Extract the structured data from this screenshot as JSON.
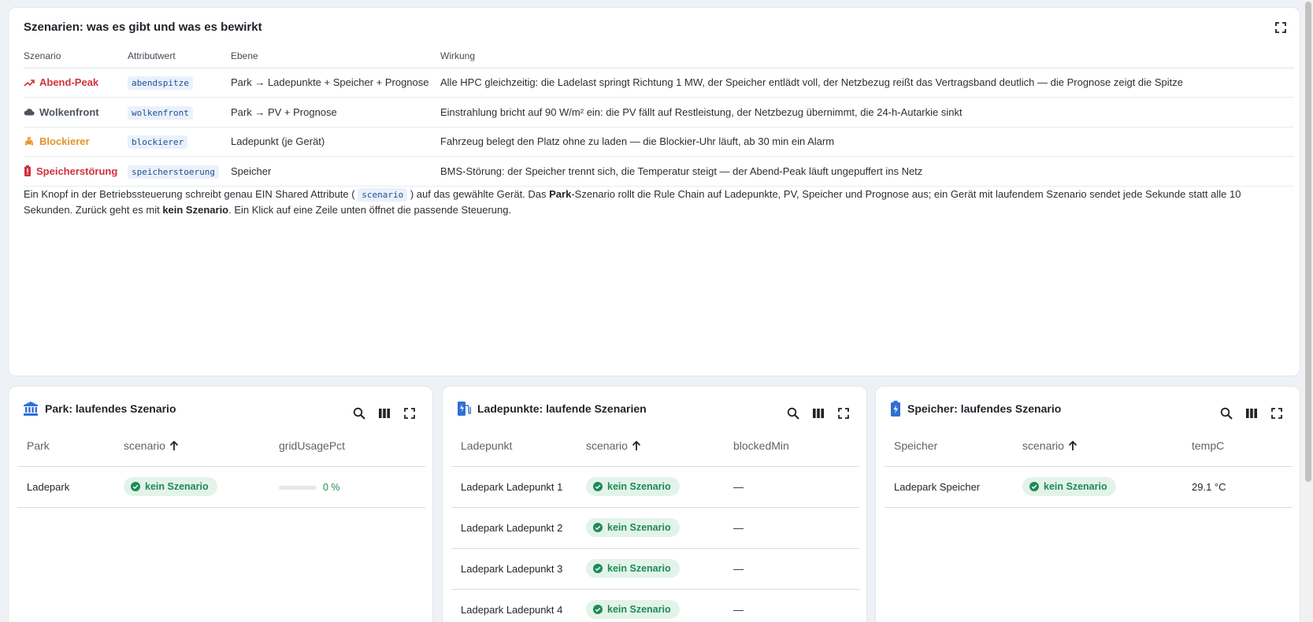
{
  "scenarios_card": {
    "title": "Szenarien: was es gibt und was es bewirkt",
    "columns": [
      "Szenario",
      "Attributwert",
      "Ebene",
      "Wirkung"
    ],
    "rows": [
      {
        "name": "Abend-Peak",
        "color": "#d0323c",
        "icon": "trending-up-icon",
        "value": "abendspitze",
        "level": "Park → Ladepunkte + Speicher + Prognose",
        "effect": "Alle HPC gleichzeitig: die Ladelast springt Richtung 1 MW, der Speicher entlädt voll, der Netzbezug reißt das Vertragsband deutlich — die Prognose zeigt die Spitze"
      },
      {
        "name": "Wolkenfront",
        "color": "#4b5562",
        "icon": "cloud-icon",
        "value": "wolkenfront",
        "level": "Park → PV + Prognose",
        "effect": "Einstrahlung bricht auf 90 W/m² ein: die PV fällt auf Restleistung, der Netzbezug übernimmt, die 24-h-Autarkie sinkt"
      },
      {
        "name": "Blockierer",
        "color": "#e3932a",
        "icon": "car-blocked-icon",
        "value": "blockierer",
        "level": "Ladepunkt (je Gerät)",
        "effect": "Fahrzeug belegt den Platz ohne zu laden — die Blockier-Uhr läuft, ab 30 min ein Alarm"
      },
      {
        "name": "Speicherstörung",
        "color": "#d0323c",
        "icon": "battery-alert-icon",
        "value": "speicherstoerung",
        "level": "Speicher",
        "effect": "BMS-Störung: der Speicher trennt sich, die Temperatur steigt — der Abend-Peak läuft ungepuffert ins Netz"
      }
    ],
    "desc": {
      "p1": "Ein Knopf in der Betriebssteuerung schreibt genau EIN Shared Attribute (",
      "code": "scenario",
      "p2": ") auf das gewählte Gerät. Das ",
      "b1": "Park",
      "p3": "-Szenario rollt die Rule Chain auf Ladepunkte, PV, Speicher und Prognose aus; ein Gerät mit laufendem Szenario sendet jede Sekunde statt alle 10 Sekunden. Zurück geht es mit ",
      "b2": "kein Szenario",
      "p4": ". Ein Klick auf eine Zeile unten öffnet die passende Steuerung."
    }
  },
  "park_card": {
    "title": "Park: laufendes Szenario",
    "columns": [
      "Park",
      "scenario",
      "gridUsagePct"
    ],
    "rows": [
      {
        "name": "Ladepark",
        "scenario": "kein Szenario",
        "grid_usage_pct": 0,
        "grid_usage_label": "0 %"
      }
    ]
  },
  "ladepunkte_card": {
    "title": "Ladepunkte: laufende Szenarien",
    "columns": [
      "Ladepunkt",
      "scenario",
      "blockedMin"
    ],
    "rows": [
      {
        "name": "Ladepark Ladepunkt 1",
        "scenario": "kein Szenario",
        "blocked": "—"
      },
      {
        "name": "Ladepark Ladepunkt 2",
        "scenario": "kein Szenario",
        "blocked": "—"
      },
      {
        "name": "Ladepark Ladepunkt 3",
        "scenario": "kein Szenario",
        "blocked": "—"
      },
      {
        "name": "Ladepark Ladepunkt 4",
        "scenario": "kein Szenario",
        "blocked": "—"
      }
    ]
  },
  "speicher_card": {
    "title": "Speicher: laufendes Szenario",
    "columns": [
      "Speicher",
      "scenario",
      "tempC"
    ],
    "rows": [
      {
        "name": "Ladepark Speicher",
        "scenario": "kein Szenario",
        "temp": "29.1 °C"
      }
    ]
  },
  "colors": {
    "accent_blue": "#2f6fd6",
    "ok_green": "#1e8a55",
    "ok_green_bg": "#e3f3ea",
    "alert_red": "#d0323c",
    "warn_orange": "#e3932a"
  }
}
